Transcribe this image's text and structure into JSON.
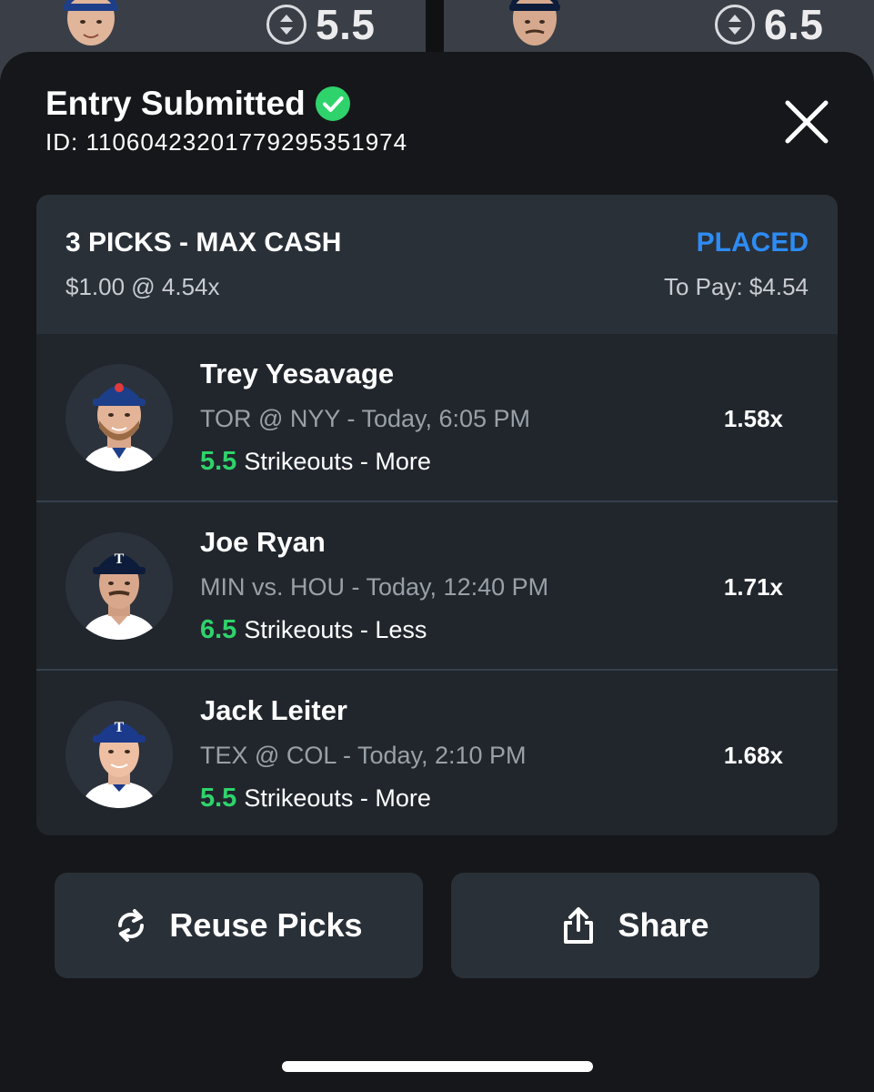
{
  "background": {
    "cards": [
      {
        "line": "5.5",
        "icon": "up-down-arrows-icon"
      },
      {
        "line": "6.5",
        "icon": "up-down-arrows-icon"
      }
    ]
  },
  "header": {
    "title": "Entry Submitted",
    "id_text": "ID: 11060423201779295351974",
    "check_icon": "check-circle-icon",
    "close_icon": "close-icon"
  },
  "entry": {
    "type": "3 PICKS - MAX CASH",
    "status": "PLACED",
    "wager": "$1.00 @ 4.54x",
    "payout": "To Pay: $4.54",
    "picks": [
      {
        "name": "Trey Yesavage",
        "game": "TOR @ NYY - Today, 6:05 PM",
        "line_value": "5.5",
        "stat": "Strikeouts - More",
        "multiplier": "1.58x",
        "cap_color": "#1d3f8a",
        "jersey_color": "#ffffff"
      },
      {
        "name": "Joe Ryan",
        "game": "MIN vs. HOU - Today, 12:40 PM",
        "line_value": "6.5",
        "stat": "Strikeouts - Less",
        "multiplier": "1.71x",
        "cap_color": "#0c1c3a",
        "jersey_color": "#ffffff"
      },
      {
        "name": "Jack Leiter",
        "game": "TEX @ COL - Today, 2:10 PM",
        "line_value": "5.5",
        "stat": "Strikeouts - More",
        "multiplier": "1.68x",
        "cap_color": "#1b3a8c",
        "jersey_color": "#ffffff"
      }
    ]
  },
  "actions": {
    "reuse": {
      "label": "Reuse Picks",
      "icon": "refresh-icon"
    },
    "share": {
      "label": "Share",
      "icon": "share-icon"
    }
  },
  "colors": {
    "accent_green": "#2fd36b",
    "status_blue": "#2d8cf5",
    "sheet_bg": "#16171a",
    "card_bg": "#21262d"
  }
}
